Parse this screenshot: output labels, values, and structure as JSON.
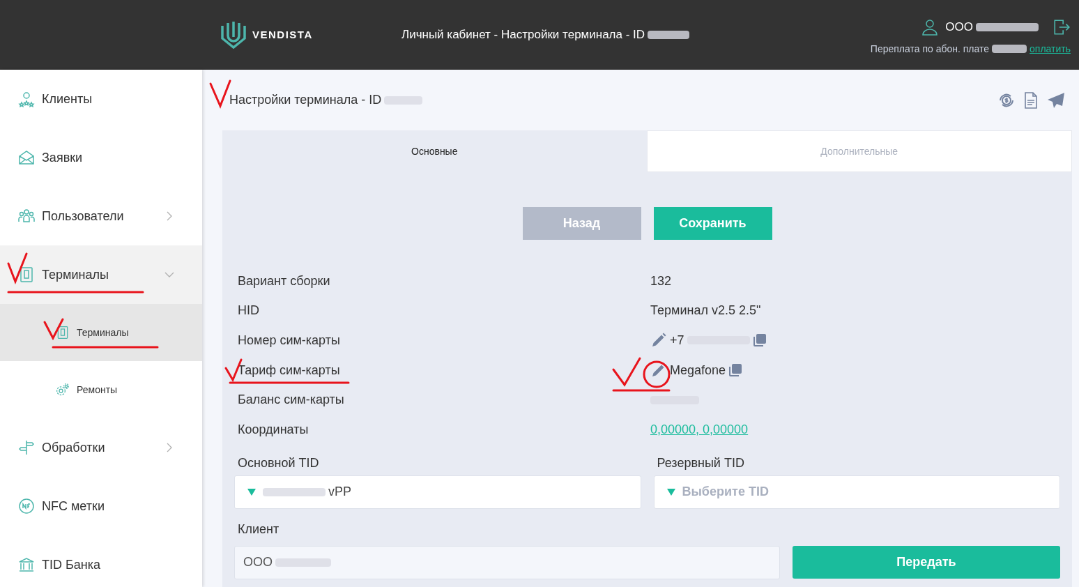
{
  "header": {
    "logo_text": "VENDISTA",
    "title": "Личный кабинет - Настройки терминала - ID",
    "title_blurred": true,
    "user": "ООО",
    "user_blurred": true,
    "balance_text": "Переплата по абон. плате",
    "pay_link": "оплатить"
  },
  "sidebar": {
    "items": [
      {
        "label": "Клиенты"
      },
      {
        "label": "Заявки"
      },
      {
        "label": "Пользователи",
        "expanded": false
      },
      {
        "label": "Терминалы",
        "expanded": true,
        "children": [
          {
            "label": "Терминалы",
            "selected": true
          },
          {
            "label": "Ремонты",
            "selected": false
          }
        ]
      },
      {
        "label": "Обработки",
        "expanded": false
      },
      {
        "label": "NFC метки"
      },
      {
        "label": "TID Банка"
      }
    ]
  },
  "page_title": "Настройки терминала - ID",
  "page_title_blurred": true,
  "tabs": [
    {
      "label": "Основные",
      "selected": true
    },
    {
      "label": "Дополнительные",
      "selected": false
    }
  ],
  "buttons": {
    "back": "Назад",
    "save": "Сохранить"
  },
  "fields": [
    {
      "kind": "text",
      "label": "Вариант сборки",
      "value": "132"
    },
    {
      "kind": "text",
      "label": "HID",
      "value": "Терминал v2.5 2.5\""
    },
    {
      "kind": "editable",
      "label": "Номер сим-карты",
      "value": "+7",
      "blurred": true
    },
    {
      "kind": "editable",
      "label": "Тариф сим-карты",
      "value": "Megafone"
    },
    {
      "kind": "hidden",
      "label": "Баланс сим-карты"
    },
    {
      "kind": "link",
      "label": "Координаты",
      "value": "0,00000, 0,00000"
    }
  ],
  "tid": {
    "primary": {
      "label": "Основной TID",
      "value": "vPP",
      "blurred_prefix": true
    },
    "reserve": {
      "label": "Резервный TID",
      "placeholder": "Выберите TID"
    }
  },
  "client": {
    "label": "Клиент",
    "value": "ООО",
    "blurred": true,
    "transfer_button": "Передать"
  }
}
